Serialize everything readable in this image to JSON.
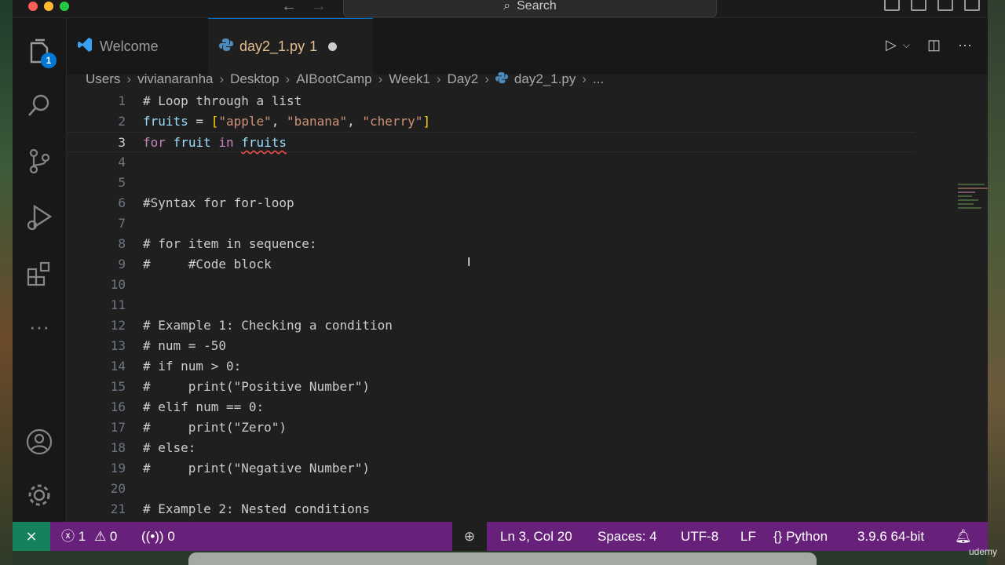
{
  "titlebar": {
    "search_label": "Search"
  },
  "activity": {
    "explorer_badge": "1"
  },
  "tabs": [
    {
      "label": "Welcome"
    },
    {
      "label": "day2_1.py",
      "problems": "1"
    }
  ],
  "breadcrumb": [
    "Users",
    "vivianaranha",
    "Desktop",
    "AIBootCamp",
    "Week1",
    "Day2",
    "day2_1.py",
    "..."
  ],
  "editor": {
    "lines": [
      "# Loop through a list",
      "fruits = [\"apple\", \"banana\", \"cherry\"]",
      "for fruit in fruits",
      "",
      "",
      "#Syntax for for-loop",
      "",
      "# for item in sequence:",
      "#     #Code block",
      "",
      "",
      "# Example 1: Checking a condition",
      "# num = -50",
      "# if num > 0:",
      "#     print(\"Positive Number\")",
      "# elif num == 0:",
      "#     print(\"Zero\")",
      "# else:",
      "#     print(\"Negative Number\")",
      "",
      "# Example 2: Nested conditions"
    ],
    "line_numbers": [
      "1",
      "2",
      "3",
      "4",
      "5",
      "6",
      "7",
      "8",
      "9",
      "10",
      "11",
      "12",
      "13",
      "14",
      "15",
      "16",
      "17",
      "18",
      "19",
      "20",
      "21"
    ],
    "current_line": 3
  },
  "status": {
    "errors": "1",
    "warnings": "0",
    "ports": "0",
    "position": "Ln 3, Col 20",
    "spaces": "Spaces: 4",
    "encoding": "UTF-8",
    "eol": "LF",
    "language": "Python",
    "interpreter": "3.9.6 64-bit"
  },
  "watermark": "udemy",
  "colors": {
    "accent": "#0078d4",
    "statusbar": "#68217a",
    "remote": "#16825d",
    "error": "#f14c4c"
  }
}
